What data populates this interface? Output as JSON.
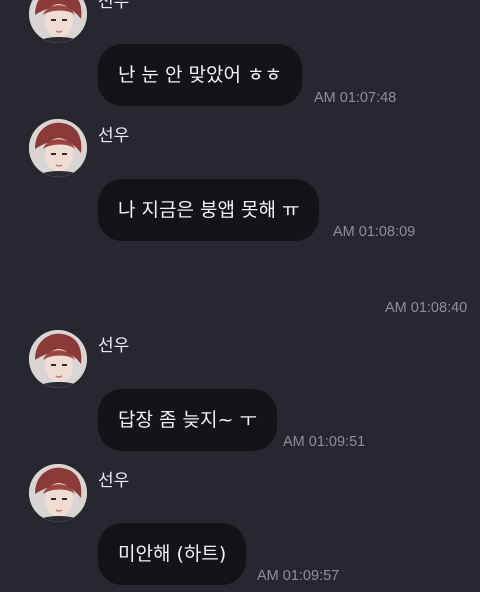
{
  "messages": [
    {
      "sender": "선우",
      "text": "난 눈 안 맞았어 ㅎㅎ",
      "time": "AM 01:07:48"
    },
    {
      "sender": "선우",
      "text": "나 지금은 붕앱 못해 ㅠ",
      "time": "AM 01:08:09"
    },
    {
      "sender": "",
      "text": "",
      "time": "AM 01:08:40"
    },
    {
      "sender": "선우",
      "text": "답장 좀 늦지~ ㅜ",
      "time": "AM 01:09:51"
    },
    {
      "sender": "선우",
      "text": "미안해 (하트)",
      "time": "AM 01:09:57"
    }
  ],
  "icons": {
    "avatar": "profile-photo-icon"
  },
  "colors": {
    "background": "#272730",
    "bubble": "#141418",
    "text": "#f2f2f5",
    "timestamp": "#8e8e96"
  }
}
